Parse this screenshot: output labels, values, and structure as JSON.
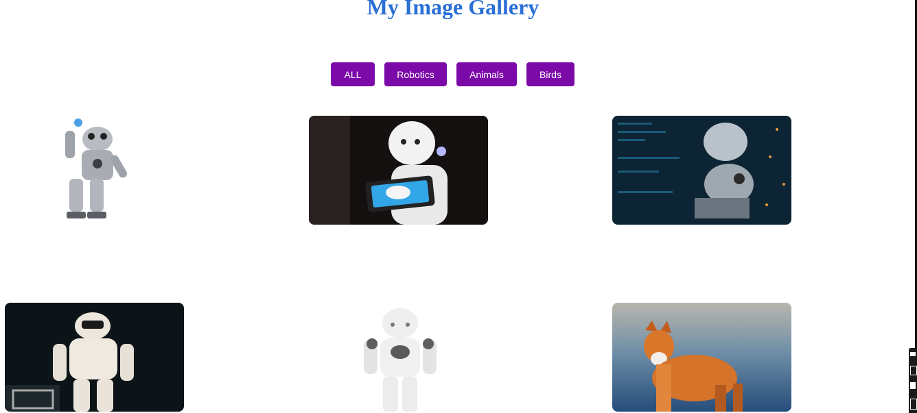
{
  "page": {
    "title": "My Image Gallery"
  },
  "colors": {
    "title": "#2a6fd6",
    "button_bg": "#7b0aa8",
    "button_text": "#ffffff"
  },
  "filters": [
    "ALL",
    "Robotics",
    "Animals",
    "Birds"
  ],
  "gallery": [
    {
      "category": "Robotics",
      "subject": "small humanoid robot waving"
    },
    {
      "category": "Robotics",
      "subject": "white robot holding tablet"
    },
    {
      "category": "Robotics",
      "subject": "robots in data center"
    },
    {
      "category": "Robotics",
      "subject": "ASIMO humanoid robot"
    },
    {
      "category": "Robotics",
      "subject": "NAO humanoid robot"
    },
    {
      "category": "Animals",
      "subject": "red fox"
    }
  ]
}
